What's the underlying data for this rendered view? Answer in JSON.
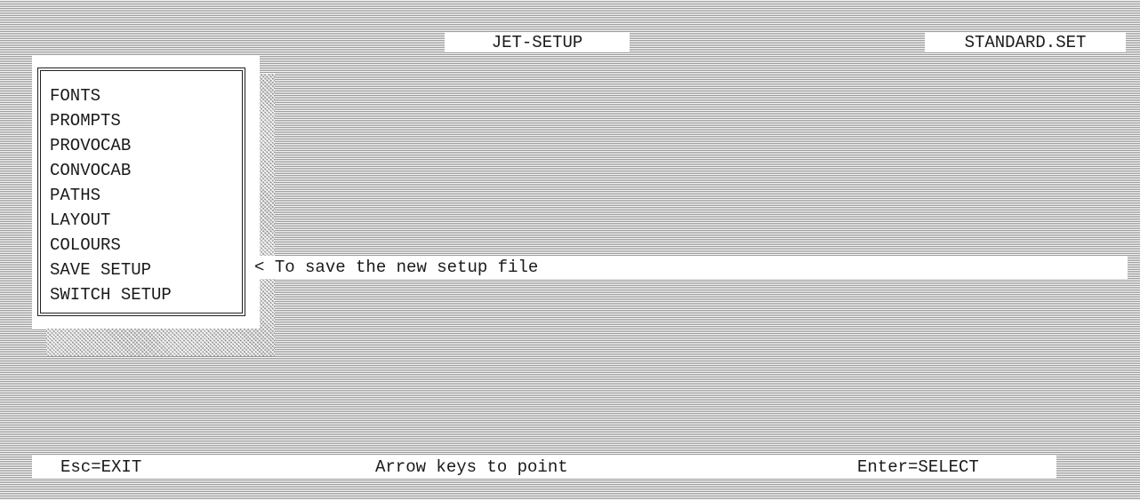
{
  "header": {
    "title": "JET-SETUP",
    "setup_file": "STANDARD.SET"
  },
  "menu": {
    "items": [
      "FONTS",
      "PROMPTS",
      "PROVOCAB",
      "CONVOCAB",
      "PATHS",
      "LAYOUT",
      "COLOURS",
      "SAVE SETUP",
      "SWITCH SETUP"
    ],
    "selected_index": 7
  },
  "hint": {
    "pointer": "<",
    "text": "To save the new setup file"
  },
  "status_bar": {
    "exit": "Esc=EXIT",
    "navigate": "Arrow keys to point",
    "select": "Enter=SELECT"
  }
}
